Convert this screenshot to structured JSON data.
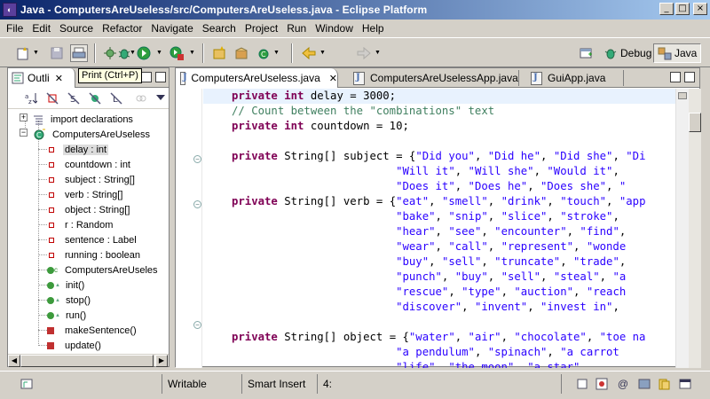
{
  "window": {
    "title": "Java - ComputersAreUseless/src/ComputersAreUseless.java - Eclipse Platform",
    "controls": {
      "minimize": "_",
      "maximize": "□",
      "close": "×"
    }
  },
  "menubar": [
    "File",
    "Edit",
    "Source",
    "Refactor",
    "Navigate",
    "Search",
    "Project",
    "Run",
    "Window",
    "Help"
  ],
  "toolbar": {
    "icons": [
      "new-icon",
      "save-icon",
      "print-icon",
      "debug-icon",
      "run-icon",
      "external-tools-icon",
      "new-java-project-icon",
      "new-package-icon",
      "new-class-icon",
      "back-icon",
      "forward-icon"
    ],
    "perspectives": [
      {
        "label": "Debug",
        "icon": "debug-perspective-icon",
        "active": false
      },
      {
        "label": "Java",
        "icon": "java-perspective-icon",
        "active": true
      }
    ]
  },
  "tooltip": {
    "text": "Print (Ctrl+P)"
  },
  "outline": {
    "tab_label": "Outli",
    "tree": [
      {
        "label": "import declarations",
        "kind": "imports",
        "level": 0
      },
      {
        "label": "ComputersAreUseless",
        "kind": "class",
        "level": 0
      },
      {
        "label": "delay : int",
        "kind": "field",
        "level": 1,
        "selected": true
      },
      {
        "label": "countdown : int",
        "kind": "field",
        "level": 1
      },
      {
        "label": "subject : String[]",
        "kind": "field",
        "level": 1
      },
      {
        "label": "verb : String[]",
        "kind": "field",
        "level": 1
      },
      {
        "label": "object : String[]",
        "kind": "field",
        "level": 1
      },
      {
        "label": "r : Random",
        "kind": "field",
        "level": 1
      },
      {
        "label": "sentence : Label",
        "kind": "field",
        "level": 1
      },
      {
        "label": "running : boolean",
        "kind": "field",
        "level": 1
      },
      {
        "label": "ComputersAreUseles",
        "kind": "constructor",
        "level": 1
      },
      {
        "label": "init()",
        "kind": "method",
        "level": 1
      },
      {
        "label": "stop()",
        "kind": "method",
        "level": 1
      },
      {
        "label": "run()",
        "kind": "method",
        "level": 1
      },
      {
        "label": "makeSentence()",
        "kind": "private-method",
        "level": 1
      },
      {
        "label": "update()",
        "kind": "private-method",
        "level": 1
      }
    ]
  },
  "editor": {
    "tabs": [
      {
        "label": "ComputersAreUseless.java",
        "active": true
      },
      {
        "label": "ComputersAreUselessApp.java",
        "active": false
      },
      {
        "label": "GuiApp.java",
        "active": false
      }
    ],
    "lines": [
      [
        {
          "t": "private int ",
          "c": "kw"
        },
        {
          "t": "delay = 3000;",
          "c": ""
        }
      ],
      [
        {
          "t": "// Count between the \"combinations\" text",
          "c": "cmt"
        }
      ],
      [
        {
          "t": "private int ",
          "c": "kw"
        },
        {
          "t": "countdown = 10;",
          "c": ""
        }
      ],
      [],
      [
        {
          "t": "private ",
          "c": "kw"
        },
        {
          "t": "String[] subject = {",
          "c": ""
        },
        {
          "t": "\"Did you\"",
          "c": "str"
        },
        {
          "t": ", ",
          "c": ""
        },
        {
          "t": "\"Did he\"",
          "c": "str"
        },
        {
          "t": ", ",
          "c": ""
        },
        {
          "t": "\"Did she\"",
          "c": "str"
        },
        {
          "t": ", ",
          "c": ""
        },
        {
          "t": "\"Di",
          "c": "str"
        }
      ],
      [
        {
          "t": "                         ",
          "c": ""
        },
        {
          "t": "\"Will it\"",
          "c": "str"
        },
        {
          "t": ", ",
          "c": ""
        },
        {
          "t": "\"Will she\"",
          "c": "str"
        },
        {
          "t": ", ",
          "c": ""
        },
        {
          "t": "\"Would it\"",
          "c": "str"
        },
        {
          "t": ", ",
          "c": ""
        }
      ],
      [
        {
          "t": "                         ",
          "c": ""
        },
        {
          "t": "\"Does it\"",
          "c": "str"
        },
        {
          "t": ", ",
          "c": ""
        },
        {
          "t": "\"Does he\"",
          "c": "str"
        },
        {
          "t": ", ",
          "c": ""
        },
        {
          "t": "\"Does she\"",
          "c": "str"
        },
        {
          "t": ", ",
          "c": ""
        },
        {
          "t": "\"",
          "c": "str"
        }
      ],
      [
        {
          "t": "private ",
          "c": "kw"
        },
        {
          "t": "String[] verb = {",
          "c": ""
        },
        {
          "t": "\"eat\"",
          "c": "str"
        },
        {
          "t": ", ",
          "c": ""
        },
        {
          "t": "\"smell\"",
          "c": "str"
        },
        {
          "t": ", ",
          "c": ""
        },
        {
          "t": "\"drink\"",
          "c": "str"
        },
        {
          "t": ", ",
          "c": ""
        },
        {
          "t": "\"touch\"",
          "c": "str"
        },
        {
          "t": ", ",
          "c": ""
        },
        {
          "t": "\"app",
          "c": "str"
        }
      ],
      [
        {
          "t": "                         ",
          "c": ""
        },
        {
          "t": "\"bake\"",
          "c": "str"
        },
        {
          "t": ", ",
          "c": ""
        },
        {
          "t": "\"snip\"",
          "c": "str"
        },
        {
          "t": ", ",
          "c": ""
        },
        {
          "t": "\"slice\"",
          "c": "str"
        },
        {
          "t": ", ",
          "c": ""
        },
        {
          "t": "\"stroke\"",
          "c": "str"
        },
        {
          "t": ",",
          "c": ""
        }
      ],
      [
        {
          "t": "                         ",
          "c": ""
        },
        {
          "t": "\"hear\"",
          "c": "str"
        },
        {
          "t": ", ",
          "c": ""
        },
        {
          "t": "\"see\"",
          "c": "str"
        },
        {
          "t": ", ",
          "c": ""
        },
        {
          "t": "\"encounter\"",
          "c": "str"
        },
        {
          "t": ", ",
          "c": ""
        },
        {
          "t": "\"find\"",
          "c": "str"
        },
        {
          "t": ",",
          "c": ""
        }
      ],
      [
        {
          "t": "                         ",
          "c": ""
        },
        {
          "t": "\"wear\"",
          "c": "str"
        },
        {
          "t": ", ",
          "c": ""
        },
        {
          "t": "\"call\"",
          "c": "str"
        },
        {
          "t": ", ",
          "c": ""
        },
        {
          "t": "\"represent\"",
          "c": "str"
        },
        {
          "t": ", ",
          "c": ""
        },
        {
          "t": "\"wonde",
          "c": "str"
        }
      ],
      [
        {
          "t": "                         ",
          "c": ""
        },
        {
          "t": "\"buy\"",
          "c": "str"
        },
        {
          "t": ", ",
          "c": ""
        },
        {
          "t": "\"sell\"",
          "c": "str"
        },
        {
          "t": ", ",
          "c": ""
        },
        {
          "t": "\"truncate\"",
          "c": "str"
        },
        {
          "t": ", ",
          "c": ""
        },
        {
          "t": "\"trade\"",
          "c": "str"
        },
        {
          "t": ",",
          "c": ""
        }
      ],
      [
        {
          "t": "                         ",
          "c": ""
        },
        {
          "t": "\"punch\"",
          "c": "str"
        },
        {
          "t": ", ",
          "c": ""
        },
        {
          "t": "\"buy\"",
          "c": "str"
        },
        {
          "t": ", ",
          "c": ""
        },
        {
          "t": "\"sell\"",
          "c": "str"
        },
        {
          "t": ", ",
          "c": ""
        },
        {
          "t": "\"steal\"",
          "c": "str"
        },
        {
          "t": ", ",
          "c": ""
        },
        {
          "t": "\"a",
          "c": "str"
        }
      ],
      [
        {
          "t": "                         ",
          "c": ""
        },
        {
          "t": "\"rescue\"",
          "c": "str"
        },
        {
          "t": ", ",
          "c": ""
        },
        {
          "t": "\"type\"",
          "c": "str"
        },
        {
          "t": ", ",
          "c": ""
        },
        {
          "t": "\"auction\"",
          "c": "str"
        },
        {
          "t": ", ",
          "c": ""
        },
        {
          "t": "\"reach",
          "c": "str"
        }
      ],
      [
        {
          "t": "                         ",
          "c": ""
        },
        {
          "t": "\"discover\"",
          "c": "str"
        },
        {
          "t": ", ",
          "c": ""
        },
        {
          "t": "\"invent\"",
          "c": "str"
        },
        {
          "t": ", ",
          "c": ""
        },
        {
          "t": "\"invest in\"",
          "c": "str"
        },
        {
          "t": ",",
          "c": ""
        }
      ],
      [],
      [
        {
          "t": "private ",
          "c": "kw"
        },
        {
          "t": "String[] object = {",
          "c": ""
        },
        {
          "t": "\"water\"",
          "c": "str"
        },
        {
          "t": ", ",
          "c": ""
        },
        {
          "t": "\"air\"",
          "c": "str"
        },
        {
          "t": ", ",
          "c": ""
        },
        {
          "t": "\"chocolate\"",
          "c": "str"
        },
        {
          "t": ", ",
          "c": ""
        },
        {
          "t": "\"toe na",
          "c": "str"
        }
      ],
      [
        {
          "t": "                         ",
          "c": ""
        },
        {
          "t": "\"a pendulum\"",
          "c": "str"
        },
        {
          "t": ", ",
          "c": ""
        },
        {
          "t": "\"spinach\"",
          "c": "str"
        },
        {
          "t": ", ",
          "c": ""
        },
        {
          "t": "\"a carrot",
          "c": "str"
        }
      ],
      [
        {
          "t": "                         ",
          "c": ""
        },
        {
          "t": "\"life\"",
          "c": "str"
        },
        {
          "t": ", ",
          "c": ""
        },
        {
          "t": "\"the moon\"",
          "c": "str"
        },
        {
          "t": ", ",
          "c": ""
        },
        {
          "t": "\"a star\"",
          "c": "str"
        },
        {
          "t": ", ",
          "c": ""
        }
      ]
    ]
  },
  "statusbar": {
    "mode": "Writable",
    "insert": "Smart Insert",
    "position": "4:"
  }
}
